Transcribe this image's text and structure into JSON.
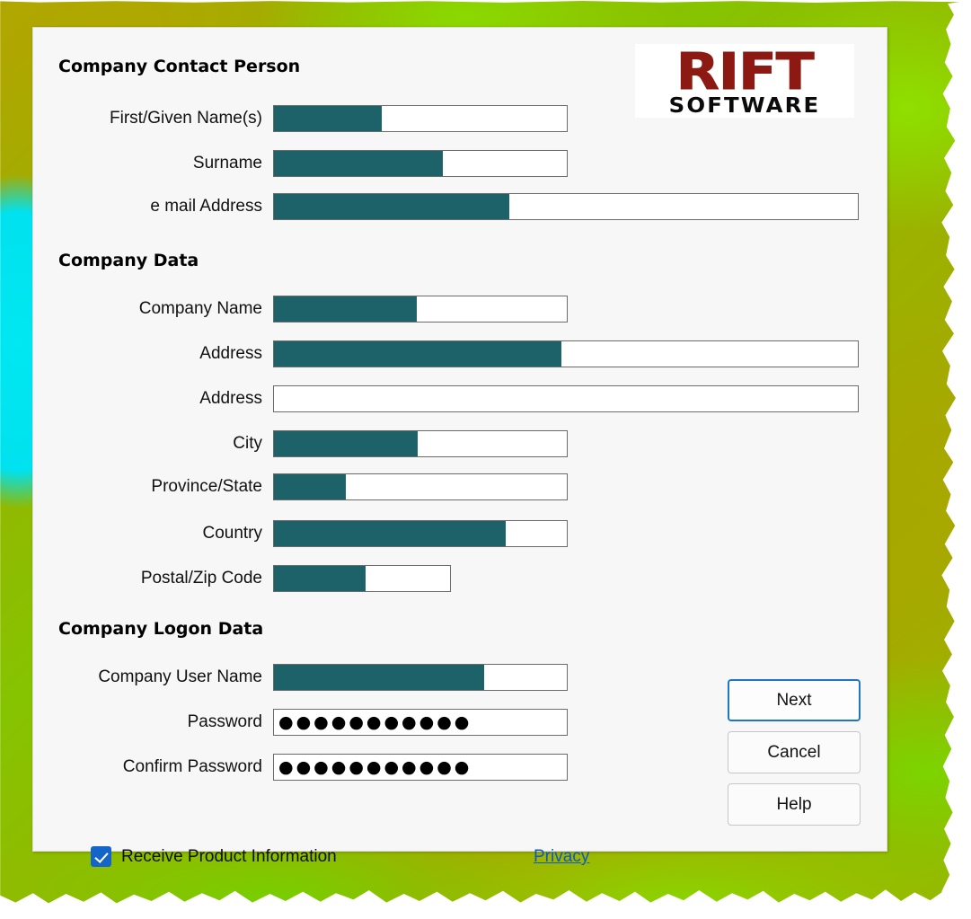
{
  "logo": {
    "primary": "RIFT",
    "secondary": "SOFTWARE",
    "primary_color": "#8c1a13",
    "secondary_color": "#0b0b0b"
  },
  "theme": {
    "panel_bg": "#f7f7f7",
    "field_fill": "#1d6268",
    "field_border": "#6b6b6b",
    "link_color": "#1057c4",
    "checkbox_color": "#1565c8",
    "focus_border": "#1d77c4"
  },
  "sections": [
    {
      "title": "Company Contact Person"
    },
    {
      "title": "Company Data"
    },
    {
      "title": "Company Logon Data"
    }
  ],
  "contact": {
    "first_name": {
      "label": "First/Given Name(s)",
      "value": "",
      "placeholder": ""
    },
    "surname": {
      "label": "Surname",
      "value": "",
      "placeholder": ""
    },
    "email": {
      "label": "e mail Address",
      "value": "",
      "placeholder": ""
    }
  },
  "company": {
    "name": {
      "label": "Company Name",
      "value": "",
      "placeholder": ""
    },
    "address1": {
      "label": "Address",
      "value": "",
      "placeholder": ""
    },
    "address2": {
      "label": "Address",
      "value": "",
      "placeholder": ""
    },
    "city": {
      "label": "City",
      "value": "",
      "placeholder": ""
    },
    "province": {
      "label": "Province/State",
      "value": "",
      "placeholder": ""
    },
    "country": {
      "label": "Country",
      "value": "",
      "placeholder": ""
    },
    "postal": {
      "label": "Postal/Zip Code",
      "value": "",
      "placeholder": ""
    }
  },
  "logon": {
    "username": {
      "label": "Company User Name",
      "value": "",
      "placeholder": ""
    },
    "password": {
      "label": "Password",
      "value": "●●●●●●●●●●●",
      "placeholder": ""
    },
    "confirm_password": {
      "label": "Confirm Password",
      "value": "●●●●●●●●●●●",
      "placeholder": ""
    }
  },
  "options": {
    "receive_info_label": "Receive Product Information",
    "receive_info_checked": "true",
    "privacy_link": "Privacy"
  },
  "buttons": {
    "next": "Next",
    "cancel": "Cancel",
    "help": "Help"
  }
}
